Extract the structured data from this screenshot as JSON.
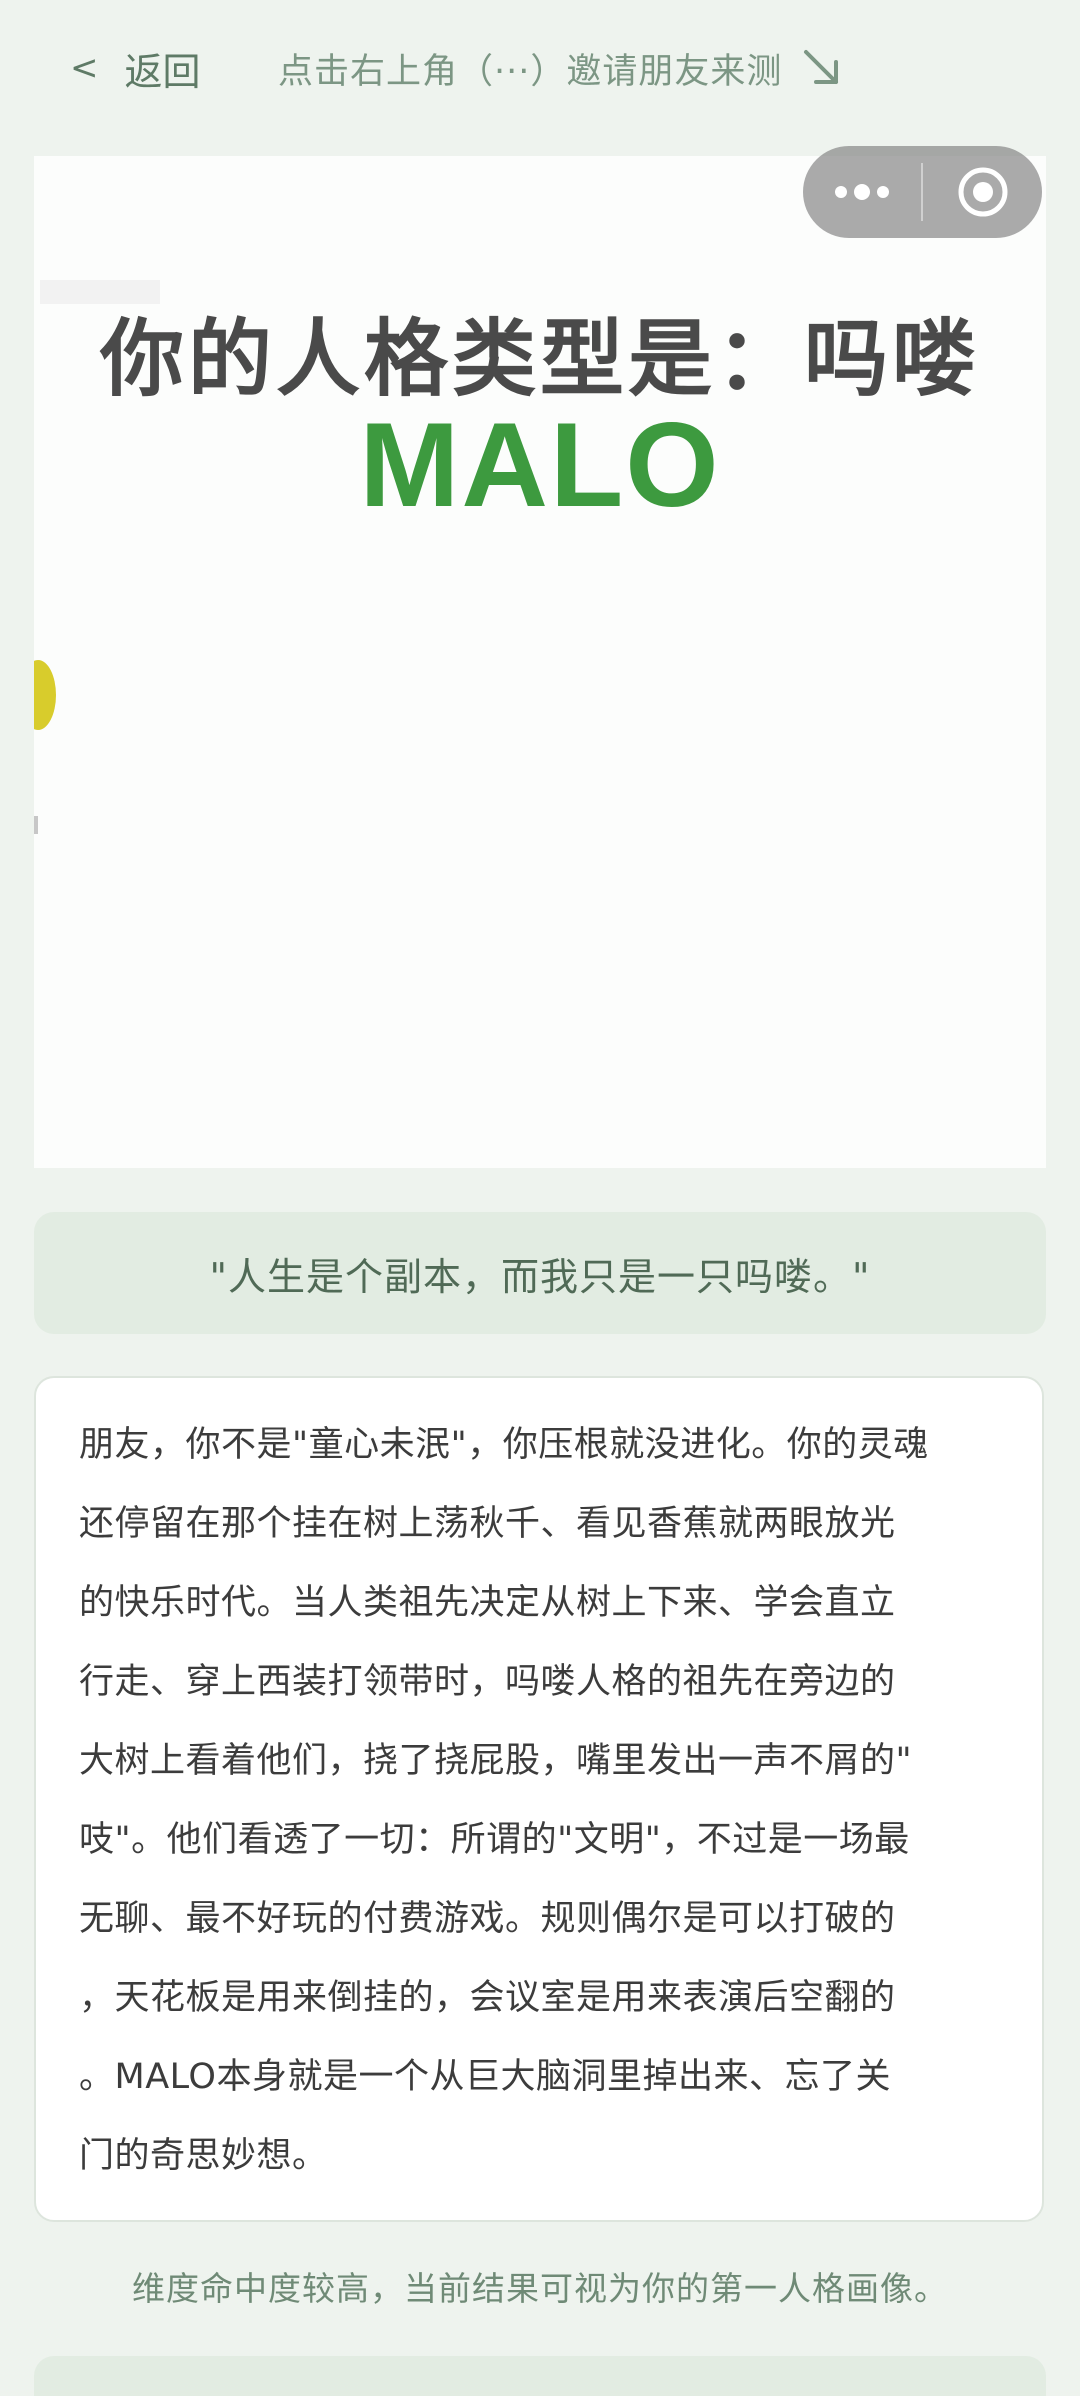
{
  "nav": {
    "back_label": "返回",
    "invite_hint": "点击右上角（···）邀请朋友来测"
  },
  "hero": {
    "title": "你的人格类型是：吗喽",
    "code": "MALO"
  },
  "quote": "\"人生是个副本，而我只是一只吗喽。\"",
  "description": {
    "lines": [
      "朋友，你不是\"童心未泯\"，你压根就没进化。你的灵魂",
      "还停留在那个挂在树上荡秋千、看见香蕉就两眼放光",
      "的快乐时代。当人类祖先决定从树上下来、学会直立",
      "行走、穿上西装打领带时，吗喽人格的祖先在旁边的",
      "大树上看着他们，挠了挠屁股，嘴里发出一声不屑的\"",
      "吱\"。他们看透了一切：所谓的\"文明\"，不过是一场最",
      "无聊、最不好玩的付费游戏。规则偶尔是可以打破的",
      "，天花板是用来倒挂的，会议室是用来表演后空翻的",
      "。MALO本身就是一个从巨大脑洞里掉出来、忘了关",
      "门的奇思妙想。"
    ]
  },
  "note": "维度命中度较高，当前结果可视为你的第一人格画像。",
  "icons": {
    "back": "chevron-left-icon",
    "hint_arrow": "arrow-down-right-icon",
    "more": "more-dots-icon",
    "close": "target-close-icon"
  },
  "colors": {
    "background": "#eef3ee",
    "accent_green": "#3d9a3f",
    "quote_bg": "#e2ece2"
  }
}
